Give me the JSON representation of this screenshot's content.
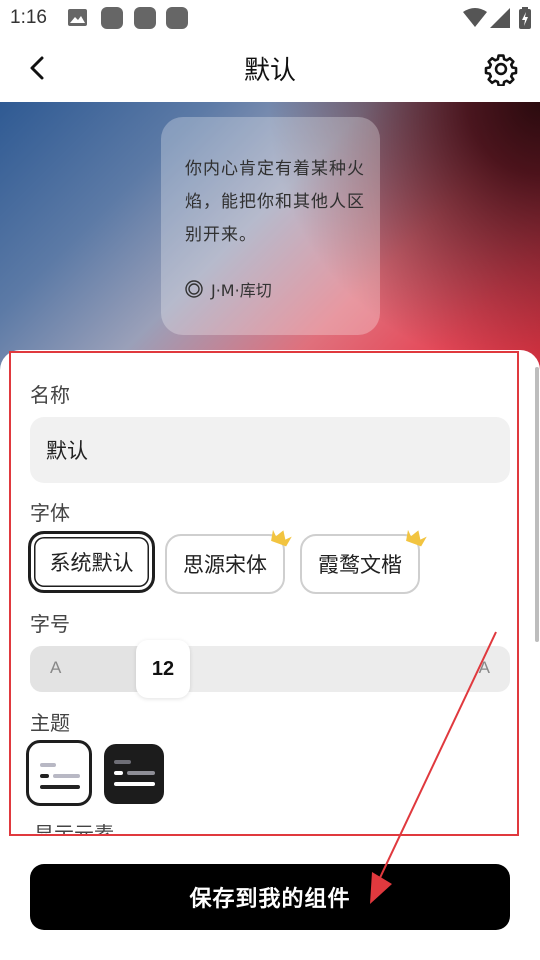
{
  "status_bar": {
    "time": "1:16"
  },
  "app_bar": {
    "title": "默认"
  },
  "preview": {
    "quote": "你内心肯定有着某种火焰，能把你和其他人区别开来。",
    "author": "J·M·库切"
  },
  "form": {
    "name_label": "名称",
    "name_value": "默认",
    "font_label": "字体",
    "fonts": [
      {
        "label": "系统默认",
        "selected": true,
        "premium": false
      },
      {
        "label": "思源宋体",
        "selected": false,
        "premium": true
      },
      {
        "label": "霞鹜文楷",
        "selected": false,
        "premium": true
      }
    ],
    "size_label": "字号",
    "size_min_label": "A",
    "size_max_label": "A",
    "size_value": "12",
    "theme_label": "主题",
    "themes": [
      "light",
      "dark"
    ],
    "selected_theme": "light",
    "elements_label": "显示元素"
  },
  "save_button": "保存到我的组件",
  "colors": {
    "annotation": "#e0393e",
    "button_bg": "#000000",
    "crown": "#f2c440"
  }
}
